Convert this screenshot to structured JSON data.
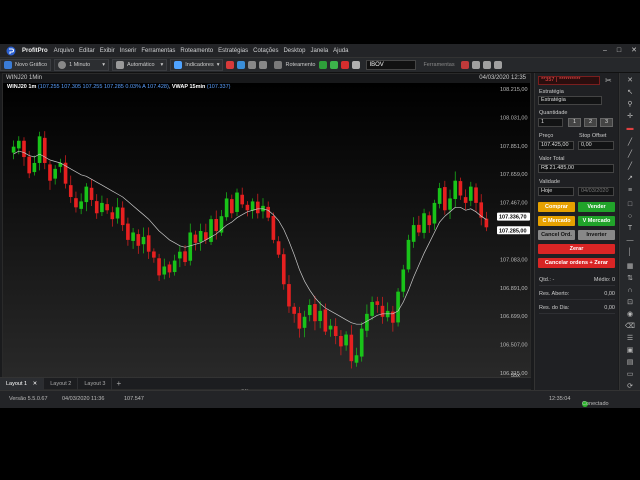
{
  "menu": {
    "app_name": "ProfitPro",
    "items": [
      "Arquivo",
      "Editar",
      "Exibir",
      "Inserir",
      "Ferramentas",
      "Roteamento",
      "Estratégias",
      "Cotações",
      "Desktop",
      "Janela",
      "Ajuda"
    ]
  },
  "toolbar": {
    "new_chart": "Novo Gráfico",
    "interval": "1 Minuto",
    "auto": "Automático",
    "indicators": "Indicadores",
    "routing": "Roteamento",
    "symbol": "IBOV",
    "tools": "Ferramentas"
  },
  "chart": {
    "title": "WINJ20 1Min",
    "datetime": "04/03/2020 12:35",
    "info_symbol": "WINJ20 1m",
    "info_values": "(107.255  107.305  107.255  107.285  0.03%  A 107.428)",
    "info_vwap": "VWAP 15min",
    "info_vwap_value": "(107.337)",
    "y_ticks": [
      "108.215,00",
      "108.031,00",
      "107.851,00",
      "107.659,00",
      "107.467,00",
      "107.275,00",
      "107.083,00",
      "106.891,00",
      "106.699,00",
      "106.507,00",
      "106.315,00"
    ],
    "x_ticks": [
      "09:54",
      "10:01",
      "10:08",
      "10:15",
      "10:22",
      "10:29",
      "10:36",
      "10:43",
      "10:50",
      "10:57",
      "11:04",
      "11:11",
      "11:18",
      "11:25",
      "11:32",
      "11:39",
      "11:46",
      "11:53",
      "12:00",
      "12:07",
      "12:14",
      "12:21",
      "12:28"
    ],
    "x_footer": "04/mar",
    "zoom": "55x",
    "price_tags": [
      "107.336,70",
      "107.285,00"
    ],
    "up_color": "#19c319",
    "down_color": "#e62020",
    "vwap_color": "#c8c8c8"
  },
  "chart_data": {
    "type": "candlestick",
    "symbol": "WINJ20",
    "interval": "1m",
    "ylim": [
      106300,
      108220
    ],
    "close": [
      107830,
      107870,
      107760,
      107650,
      107720,
      107900,
      107720,
      107600,
      107680,
      107720,
      107580,
      107490,
      107420,
      107460,
      107560,
      107470,
      107380,
      107450,
      107400,
      107340,
      107420,
      107300,
      107200,
      107250,
      107160,
      107220,
      107120,
      107080,
      106960,
      107020,
      106980,
      107060,
      107120,
      107050,
      107250,
      107180,
      107260,
      107200,
      107340,
      107260,
      107360,
      107480,
      107380,
      107520,
      107440,
      107400,
      107460,
      107380,
      107430,
      107350,
      107200,
      107100,
      106900,
      106750,
      106700,
      106600,
      106680,
      106760,
      106650,
      106720,
      106580,
      106620,
      106550,
      106480,
      106560,
      106380,
      106420,
      106600,
      106700,
      106780,
      106760,
      106680,
      106720,
      106640,
      106850,
      107000,
      107200,
      107300,
      107250,
      107380,
      107300,
      107450,
      107550,
      107400,
      107480,
      107600,
      107500,
      107450,
      107560,
      107450,
      107350,
      107285
    ],
    "vwap": [
      107780,
      107800,
      107790,
      107770,
      107760,
      107780,
      107760,
      107740,
      107730,
      107720,
      107700,
      107680,
      107660,
      107640,
      107630,
      107610,
      107590,
      107570,
      107550,
      107530,
      107510,
      107490,
      107460,
      107430,
      107400,
      107370,
      107340,
      107300,
      107260,
      107230,
      107200,
      107180,
      107160,
      107150,
      107160,
      107170,
      107180,
      107200,
      107220,
      107240,
      107270,
      107300,
      107320,
      107350,
      107370,
      107390,
      107400,
      107410,
      107410,
      107400,
      107370,
      107330,
      107270,
      107190,
      107100,
      107000,
      106920,
      106860,
      106810,
      106770,
      106740,
      106720,
      106700,
      106680,
      106660,
      106640,
      106630,
      106630,
      106650,
      106670,
      106690,
      106700,
      106700,
      106700,
      106720,
      106780,
      106860,
      106950,
      107030,
      107110,
      107180,
      107250,
      107320,
      107360,
      107390,
      107420,
      107420,
      107400,
      107410,
      107390,
      107360,
      107337
    ]
  },
  "order_panel": {
    "account": "**357 | **********",
    "strategy_label": "Estratégia",
    "strategy_value": "Estratégia",
    "quantity_label": "Quantidade",
    "quantity_value": "1",
    "qty_buttons": [
      "1",
      "2",
      "3"
    ],
    "price_label": "Preço",
    "price_value": "107.425,00",
    "stop_label": "Stop Offset",
    "stop_value": "0,00",
    "total_label": "Valor Total",
    "total_value": "R$ 21.485,00",
    "validity_label": "Validade",
    "validity_value": "Hoje",
    "validity_date": "04/03/2020",
    "buy": "Comprar",
    "sell": "Vender",
    "market_buy": "C Mercado",
    "market_sell": "V Mercado",
    "cancel_orders": "Cancel Ord.",
    "invert": "Inverter",
    "zero": "Zerar",
    "cancel_zero": "Cancelar ordens + Zerar",
    "qtd_label": "Qtd.:",
    "qtd_value": "-",
    "avg_label": "Médio:",
    "avg_value": "0",
    "open_label": "Res. Aberto:",
    "open_value": "0,00",
    "day_label": "Res. do Dia:",
    "day_value": "0,00",
    "colors": {
      "buy": "#e6a100",
      "sell": "#21a32a",
      "market_buy": "#e6a100",
      "market_sell": "#21a32a",
      "cancel": "#888888",
      "zero": "#d92525"
    }
  },
  "tabs": [
    "Layout 1",
    "Layout 2",
    "Layout 3"
  ],
  "status": {
    "version": "Versão 5.5.0.67",
    "timestamp": "04/03/2020 11:36",
    "value": "107.547",
    "clock": "12:35:04",
    "connection": "Conectado"
  }
}
